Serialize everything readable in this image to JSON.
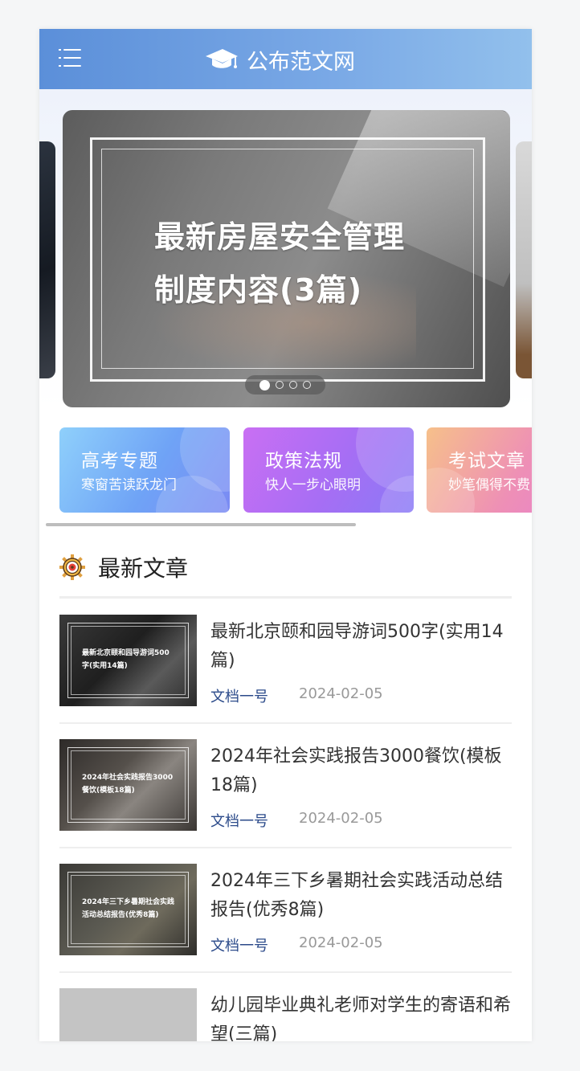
{
  "header": {
    "title": "公布范文网"
  },
  "carousel": {
    "slide_title_line1": "最新房屋安全管理",
    "slide_title_line2": "制度内容(3篇)",
    "dot_count": 4,
    "active_index": 0
  },
  "categories": [
    {
      "title": "高考专题",
      "subtitle": "寒窗苦读跃龙门"
    },
    {
      "title": "政策法规",
      "subtitle": "快人一步心眼明"
    },
    {
      "title": "考试文章",
      "subtitle": "妙笔偶得不费"
    }
  ],
  "latest": {
    "title": "最新文章",
    "articles": [
      {
        "title": "最新北京颐和园导游词500字(实用14篇)",
        "thumb_text": "最新北京颐和园导游词500字(实用14篇)",
        "author": "文档一号",
        "date": "2024-02-05"
      },
      {
        "title": "2024年社会实践报告3000餐饮(模板18篇)",
        "thumb_text": "2024年社会实践报告3000餐饮(模板18篇)",
        "author": "文档一号",
        "date": "2024-02-05"
      },
      {
        "title": "2024年三下乡暑期社会实践活动总结报告(优秀8篇)",
        "thumb_text": "2024年三下乡暑期社会实践活动总结报告(优秀8篇)",
        "author": "文档一号",
        "date": "2024-02-05"
      },
      {
        "title": "幼儿园毕业典礼老师对学生的寄语和希望(三篇)"
      }
    ]
  }
}
